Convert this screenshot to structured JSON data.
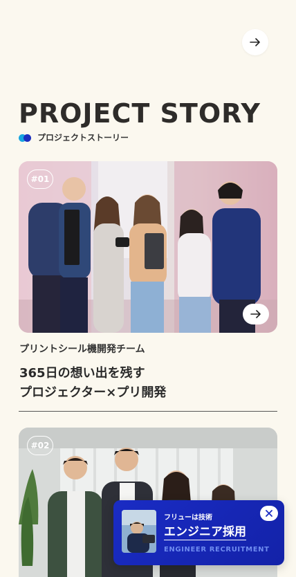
{
  "header": {
    "next_icon": "arrow-right-icon"
  },
  "section": {
    "title": "PROJECT STORY",
    "subtitle": "プロジェクトストーリー",
    "accent_colors": [
      "#18a5e0",
      "#1c2fbf"
    ]
  },
  "stories": [
    {
      "badge": "#01",
      "team": "プリントシール機開発チーム",
      "title_line1": "365日の想い出を残す",
      "title_line2": "プロジェクター×プリ開発"
    },
    {
      "badge": "#02"
    }
  ],
  "recruit_banner": {
    "small_label": "フリューは技術",
    "main_label": "エンジニア採用",
    "english_label": "ENGINEER RECRUITMENT",
    "background": "#1a2cc4",
    "close_icon": "close-icon"
  }
}
